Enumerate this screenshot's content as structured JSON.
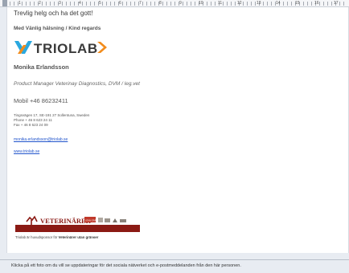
{
  "ruler": {
    "labels": [
      "1",
      "2",
      "3",
      "4",
      "5",
      "6",
      "7",
      "8",
      "9",
      "10",
      "11",
      "12",
      "13",
      "14",
      "15",
      "16",
      "17"
    ]
  },
  "signature": {
    "greeting": "Trevlig helg och ha det gott!",
    "regards": "Med Vänlig hälsning / Kind regards",
    "logo_text": "TRIOLAB",
    "name": "Monika Erlandsson",
    "title": "Product Manager Veterinay Diagnostics, DVM / leg.vet",
    "mobile": "Mobil +46 86232411",
    "address_lines": [
      "Tingsvägen 17, SE-191 27 Sollentuna, Sweden",
      "Phone + 46 8 623 24 11",
      "Fax + 46 8 623 24 09"
    ],
    "email": "monika.erlandsson@triolab.se",
    "website": "www.triolab.se",
    "banner_text": "VETERINÄRER",
    "banner_tag": "UTAN GRÄNSER",
    "sponsor_prefix": "Triolab är huvudsponsor för ",
    "sponsor_org": "Veterinärer utan gränser"
  },
  "social_bar": {
    "message": "Klicka på ett foto om du vill se uppdateringar för det sociala nätverket och e-postmeddelanden från den här personen."
  },
  "colors": {
    "logo_accent": "#f28c1c",
    "logo_blue": "#2aa8df",
    "logo_text": "#3a3a3a",
    "banner_red": "#8b1a14",
    "link": "#2255cc"
  }
}
